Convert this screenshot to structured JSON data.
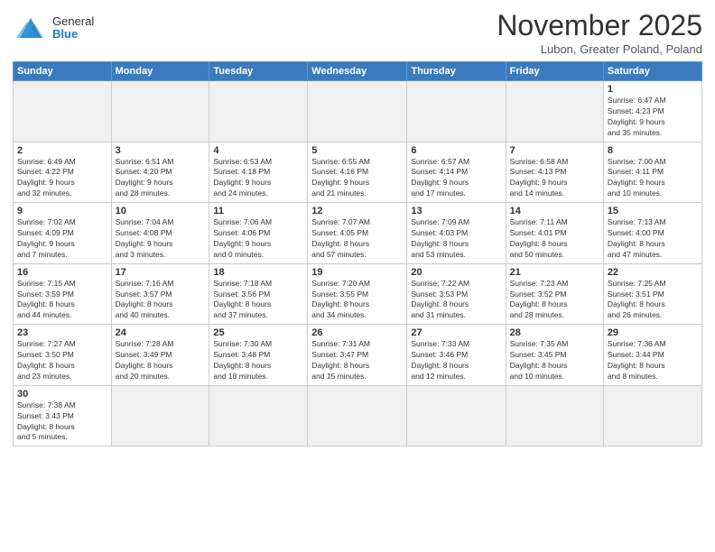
{
  "header": {
    "logo_general": "General",
    "logo_blue": "Blue",
    "title": "November 2025",
    "subtitle": "Lubon, Greater Poland, Poland"
  },
  "days_of_week": [
    "Sunday",
    "Monday",
    "Tuesday",
    "Wednesday",
    "Thursday",
    "Friday",
    "Saturday"
  ],
  "weeks": [
    [
      {
        "date": "",
        "info": ""
      },
      {
        "date": "",
        "info": ""
      },
      {
        "date": "",
        "info": ""
      },
      {
        "date": "",
        "info": ""
      },
      {
        "date": "",
        "info": ""
      },
      {
        "date": "",
        "info": ""
      },
      {
        "date": "1",
        "info": "Sunrise: 6:47 AM\nSunset: 4:23 PM\nDaylight: 9 hours\nand 35 minutes."
      }
    ],
    [
      {
        "date": "2",
        "info": "Sunrise: 6:49 AM\nSunset: 4:22 PM\nDaylight: 9 hours\nand 32 minutes."
      },
      {
        "date": "3",
        "info": "Sunrise: 6:51 AM\nSunset: 4:20 PM\nDaylight: 9 hours\nand 28 minutes."
      },
      {
        "date": "4",
        "info": "Sunrise: 6:53 AM\nSunset: 4:18 PM\nDaylight: 9 hours\nand 24 minutes."
      },
      {
        "date": "5",
        "info": "Sunrise: 6:55 AM\nSunset: 4:16 PM\nDaylight: 9 hours\nand 21 minutes."
      },
      {
        "date": "6",
        "info": "Sunrise: 6:57 AM\nSunset: 4:14 PM\nDaylight: 9 hours\nand 17 minutes."
      },
      {
        "date": "7",
        "info": "Sunrise: 6:58 AM\nSunset: 4:13 PM\nDaylight: 9 hours\nand 14 minutes."
      },
      {
        "date": "8",
        "info": "Sunrise: 7:00 AM\nSunset: 4:11 PM\nDaylight: 9 hours\nand 10 minutes."
      }
    ],
    [
      {
        "date": "9",
        "info": "Sunrise: 7:02 AM\nSunset: 4:09 PM\nDaylight: 9 hours\nand 7 minutes."
      },
      {
        "date": "10",
        "info": "Sunrise: 7:04 AM\nSunset: 4:08 PM\nDaylight: 9 hours\nand 3 minutes."
      },
      {
        "date": "11",
        "info": "Sunrise: 7:06 AM\nSunset: 4:06 PM\nDaylight: 9 hours\nand 0 minutes."
      },
      {
        "date": "12",
        "info": "Sunrise: 7:07 AM\nSunset: 4:05 PM\nDaylight: 8 hours\nand 57 minutes."
      },
      {
        "date": "13",
        "info": "Sunrise: 7:09 AM\nSunset: 4:03 PM\nDaylight: 8 hours\nand 53 minutes."
      },
      {
        "date": "14",
        "info": "Sunrise: 7:11 AM\nSunset: 4:01 PM\nDaylight: 8 hours\nand 50 minutes."
      },
      {
        "date": "15",
        "info": "Sunrise: 7:13 AM\nSunset: 4:00 PM\nDaylight: 8 hours\nand 47 minutes."
      }
    ],
    [
      {
        "date": "16",
        "info": "Sunrise: 7:15 AM\nSunset: 3:59 PM\nDaylight: 8 hours\nand 44 minutes."
      },
      {
        "date": "17",
        "info": "Sunrise: 7:16 AM\nSunset: 3:57 PM\nDaylight: 8 hours\nand 40 minutes."
      },
      {
        "date": "18",
        "info": "Sunrise: 7:18 AM\nSunset: 3:56 PM\nDaylight: 8 hours\nand 37 minutes."
      },
      {
        "date": "19",
        "info": "Sunrise: 7:20 AM\nSunset: 3:55 PM\nDaylight: 8 hours\nand 34 minutes."
      },
      {
        "date": "20",
        "info": "Sunrise: 7:22 AM\nSunset: 3:53 PM\nDaylight: 8 hours\nand 31 minutes."
      },
      {
        "date": "21",
        "info": "Sunrise: 7:23 AM\nSunset: 3:52 PM\nDaylight: 8 hours\nand 28 minutes."
      },
      {
        "date": "22",
        "info": "Sunrise: 7:25 AM\nSunset: 3:51 PM\nDaylight: 8 hours\nand 26 minutes."
      }
    ],
    [
      {
        "date": "23",
        "info": "Sunrise: 7:27 AM\nSunset: 3:50 PM\nDaylight: 8 hours\nand 23 minutes."
      },
      {
        "date": "24",
        "info": "Sunrise: 7:28 AM\nSunset: 3:49 PM\nDaylight: 8 hours\nand 20 minutes."
      },
      {
        "date": "25",
        "info": "Sunrise: 7:30 AM\nSunset: 3:48 PM\nDaylight: 8 hours\nand 18 minutes."
      },
      {
        "date": "26",
        "info": "Sunrise: 7:31 AM\nSunset: 3:47 PM\nDaylight: 8 hours\nand 15 minutes."
      },
      {
        "date": "27",
        "info": "Sunrise: 7:33 AM\nSunset: 3:46 PM\nDaylight: 8 hours\nand 12 minutes."
      },
      {
        "date": "28",
        "info": "Sunrise: 7:35 AM\nSunset: 3:45 PM\nDaylight: 8 hours\nand 10 minutes."
      },
      {
        "date": "29",
        "info": "Sunrise: 7:36 AM\nSunset: 3:44 PM\nDaylight: 8 hours\nand 8 minutes."
      }
    ],
    [
      {
        "date": "30",
        "info": "Sunrise: 7:38 AM\nSunset: 3:43 PM\nDaylight: 8 hours\nand 5 minutes."
      },
      {
        "date": "",
        "info": ""
      },
      {
        "date": "",
        "info": ""
      },
      {
        "date": "",
        "info": ""
      },
      {
        "date": "",
        "info": ""
      },
      {
        "date": "",
        "info": ""
      },
      {
        "date": "",
        "info": ""
      }
    ]
  ]
}
